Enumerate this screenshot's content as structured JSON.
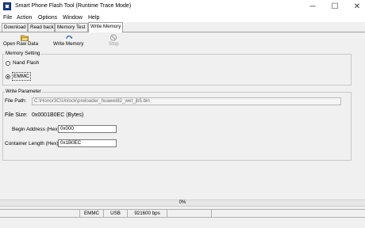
{
  "window": {
    "title": "Smart Phone Flash Tool (Runtime Trace Mode)",
    "minimize_glyph": "─",
    "maximize_glyph": "☐",
    "close_glyph": "✕"
  },
  "menu": [
    "File",
    "Action",
    "Options",
    "Window",
    "Help"
  ],
  "tabs": [
    "Download",
    "Read back",
    "Memory Test",
    "Write Memory"
  ],
  "active_tab": "Write Memory",
  "toolbar": {
    "open_raw_data": "Open Raw Data",
    "write_memory": "Write Memory",
    "stop": "Stop"
  },
  "memory_setting": {
    "title": "Memory Setting",
    "options": [
      "Nand Flash",
      "EMMC"
    ],
    "selected": "EMMC"
  },
  "write_parameter": {
    "title": "Write Parameter",
    "file_path_label": "File Path:",
    "file_path_value": "C:\\Honor3C\\Unlock\\preloader_huawei82_wet_jb5.bin",
    "file_size_label": "File Size:",
    "file_size_value": "0x0001B0EC (Bytes)",
    "begin_address_label": "Begin Address (Hex) :",
    "begin_address_value": "0x000",
    "container_length_label": "Container Length (Hex) :",
    "container_length_value": "0x1B0EC"
  },
  "progress": {
    "percent_text": "0%",
    "fraction": 0
  },
  "status": {
    "storage": "EMMC",
    "port": "USB",
    "baud": "921600 bps"
  },
  "colors": {
    "window_bg": "#f0f0f0",
    "app_icon": "#1f3f9a",
    "stop_disabled": "#9a9a9a"
  }
}
